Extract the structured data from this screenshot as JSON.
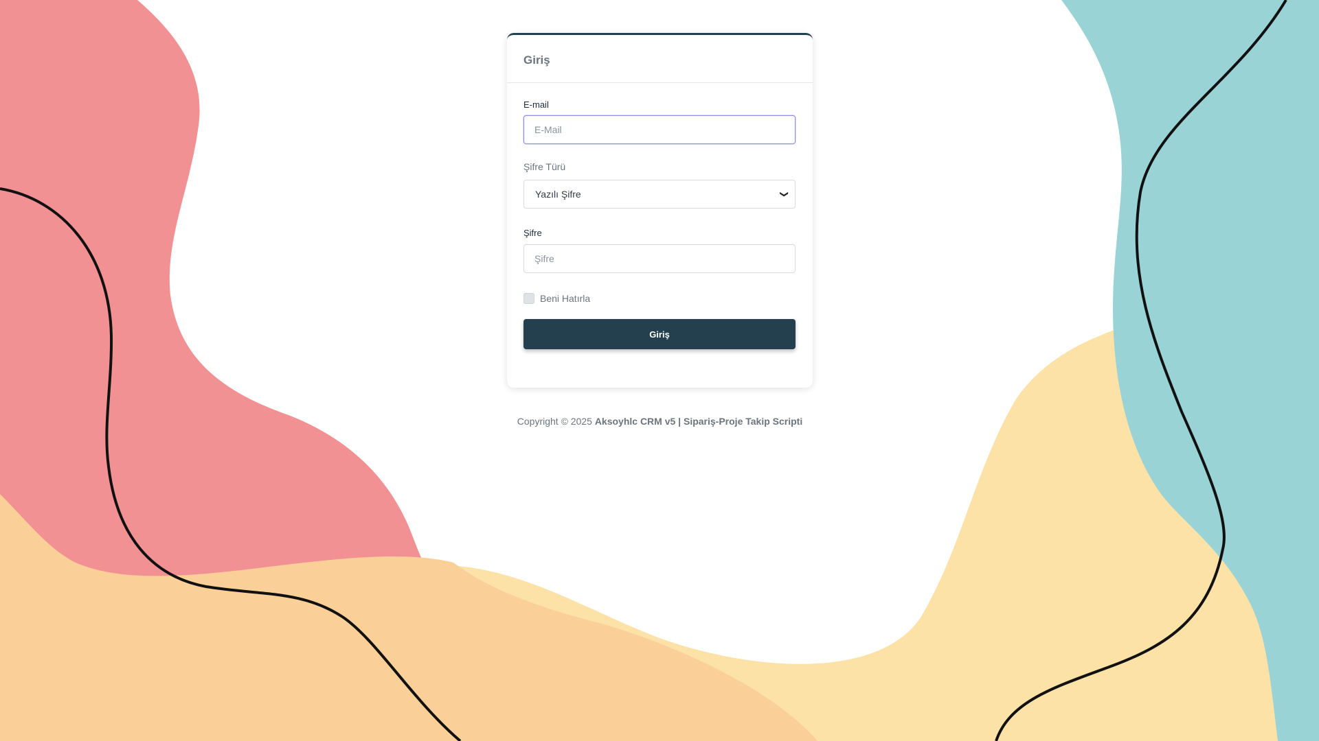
{
  "theme": {
    "accent": "#243f4d",
    "blob_red": "#f29193",
    "blob_peach": "#facf98",
    "blob_yellow": "#fde2a8",
    "blob_teal": "#9ad3d6",
    "focus_border": "#8b8fe8"
  },
  "card": {
    "title": "Giriş"
  },
  "form": {
    "email_label": "E-mail",
    "email_placeholder": "E-Mail",
    "email_value": "",
    "password_type_label": "Şifre Türü",
    "password_type_selected": "Yazılı Şifre",
    "password_label": "Şifre",
    "password_placeholder": "Şifre",
    "password_value": "",
    "remember_label": "Beni Hatırla",
    "remember_checked": false,
    "submit_label": "Giriş"
  },
  "icons": {
    "select_chevron": "chevron-down-icon"
  },
  "footer": {
    "prefix": "Copyright © 2025",
    "product": "Aksoyhlc CRM v5 | Sipariş-Proje Takip Scripti"
  }
}
